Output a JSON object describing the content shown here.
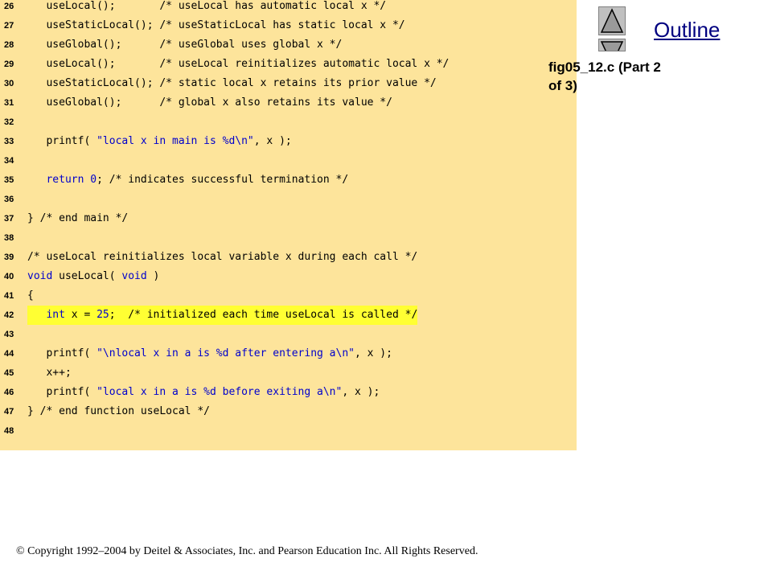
{
  "slide": {
    "outline_label": "Outline",
    "subtitle_line1": "fig05_12.c (Part 2",
    "subtitle_line2": "of 3)",
    "copyright": "© Copyright 1992–2004 by Deitel & Associates, Inc. and Pearson Education Inc. All Rights Reserved."
  },
  "colors": {
    "code_background": "#fde49b",
    "highlight": "#ffff33",
    "keyword": "#0000cc",
    "outline_link": "#000080"
  },
  "code": {
    "lines": [
      {
        "num": "26",
        "text": "   useLocal();       /* useLocal has automatic local x */"
      },
      {
        "num": "27",
        "text": "   useStaticLocal(); /* useStaticLocal has static local x */"
      },
      {
        "num": "28",
        "text": "   useGlobal();      /* useGlobal uses global x */"
      },
      {
        "num": "29",
        "text": "   useLocal();       /* useLocal reinitializes automatic local x */"
      },
      {
        "num": "30",
        "text": "   useStaticLocal(); /* static local x retains its prior value */"
      },
      {
        "num": "31",
        "text": "   useGlobal();      /* global x also retains its value */"
      },
      {
        "num": "32",
        "text": ""
      },
      {
        "num": "33",
        "text": "   printf( \"local x in main is %d\\n\", x );"
      },
      {
        "num": "34",
        "text": ""
      },
      {
        "num": "35",
        "text": "   return 0; /* indicates successful termination */"
      },
      {
        "num": "36",
        "text": ""
      },
      {
        "num": "37",
        "text": "} /* end main */"
      },
      {
        "num": "38",
        "text": ""
      },
      {
        "num": "39",
        "text": "/* useLocal reinitializes local variable x during each call */"
      },
      {
        "num": "40",
        "text": "void useLocal( void )"
      },
      {
        "num": "41",
        "text": "{"
      },
      {
        "num": "42",
        "text": "   int x = 25;  /* initialized each time useLocal is called */",
        "highlight": true
      },
      {
        "num": "43",
        "text": ""
      },
      {
        "num": "44",
        "text": "   printf( \"\\nlocal x in a is %d after entering a\\n\", x );"
      },
      {
        "num": "45",
        "text": "   x++;"
      },
      {
        "num": "46",
        "text": "   printf( \"local x in a is %d before exiting a\\n\", x );"
      },
      {
        "num": "47",
        "text": "} /* end function useLocal */"
      },
      {
        "num": "48",
        "text": ""
      }
    ]
  }
}
